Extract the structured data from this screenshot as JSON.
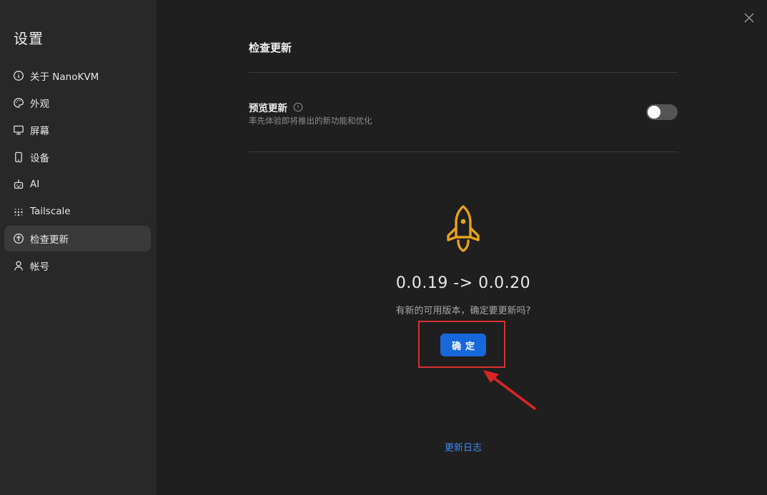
{
  "sidebar": {
    "title": "设置",
    "items": [
      {
        "label": "关于 NanoKVM",
        "icon": "info-circle-icon"
      },
      {
        "label": "外观",
        "icon": "palette-icon"
      },
      {
        "label": "屏幕",
        "icon": "monitor-icon"
      },
      {
        "label": "设备",
        "icon": "phone-icon"
      },
      {
        "label": "AI",
        "icon": "robot-icon"
      },
      {
        "label": "Tailscale",
        "icon": "tailscale-dots-icon"
      },
      {
        "label": "检查更新",
        "icon": "arrow-up-circle-icon",
        "active": true
      },
      {
        "label": "帐号",
        "icon": "user-icon"
      }
    ]
  },
  "main": {
    "title": "检查更新",
    "preview": {
      "label": "预览更新",
      "description": "率先体验即将推出的新功能和优化",
      "enabled": false
    },
    "update": {
      "version_text": "0.0.19 -> 0.0.20",
      "question": "有新的可用版本，确定要更新吗?",
      "confirm_label": "确定",
      "changelog_label": "更新日志"
    }
  },
  "colors": {
    "accent": "#1668dc",
    "rocket": "#e8a21a",
    "highlight": "#d93030",
    "link": "#3c8cf0"
  }
}
